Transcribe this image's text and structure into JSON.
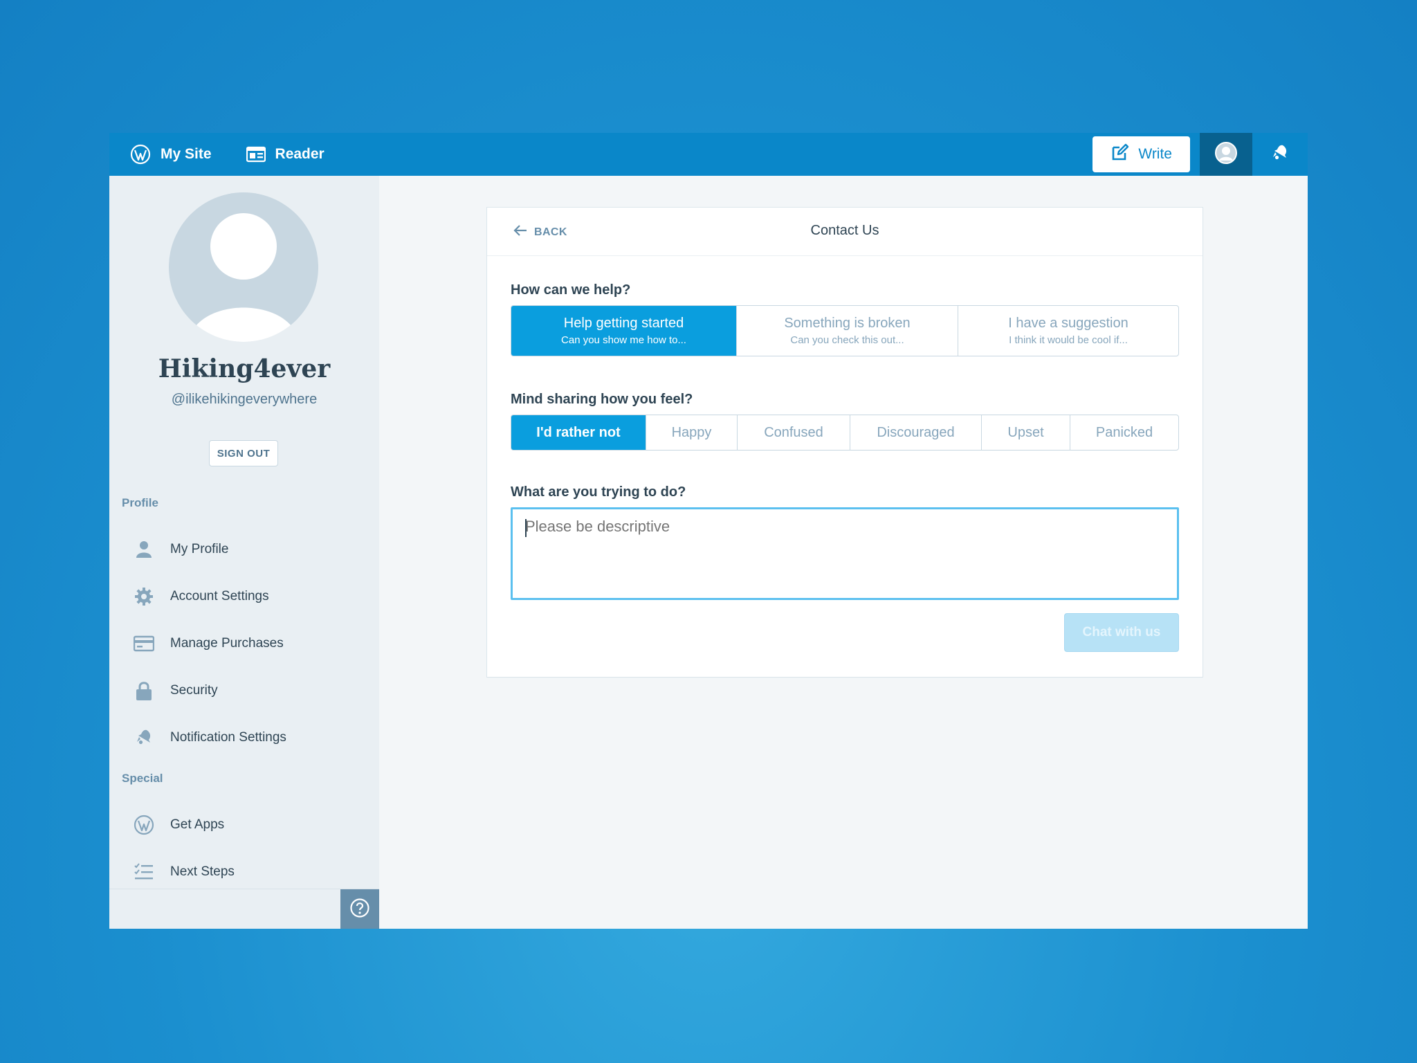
{
  "masterbar": {
    "my_site": "My Site",
    "reader": "Reader",
    "write": "Write"
  },
  "profile": {
    "display_name": "Hiking4ever",
    "username": "@ilikehikingeverywhere",
    "sign_out": "SIGN OUT"
  },
  "sidebar": {
    "profile_section": "Profile",
    "profile_items": [
      {
        "label": "My Profile",
        "icon": "user-icon"
      },
      {
        "label": "Account Settings",
        "icon": "gear-icon"
      },
      {
        "label": "Manage Purchases",
        "icon": "credit-card-icon"
      },
      {
        "label": "Security",
        "icon": "lock-icon"
      },
      {
        "label": "Notification Settings",
        "icon": "bell-icon"
      }
    ],
    "special_section": "Special",
    "special_items": [
      {
        "label": "Get Apps",
        "icon": "wordpress-icon"
      },
      {
        "label": "Next Steps",
        "icon": "checklist-icon"
      }
    ]
  },
  "contact": {
    "back": "BACK",
    "title": "Contact Us",
    "help_question": "How can we help?",
    "help_options": [
      {
        "title": "Help getting started",
        "subtitle": "Can you show me how to...",
        "selected": true
      },
      {
        "title": "Something is broken",
        "subtitle": "Can you check this out...",
        "selected": false
      },
      {
        "title": "I have a suggestion",
        "subtitle": "I think it would be cool if...",
        "selected": false
      }
    ],
    "feel_question": "Mind sharing how you feel?",
    "feel_options": [
      "I'd rather not",
      "Happy",
      "Confused",
      "Discouraged",
      "Upset",
      "Panicked"
    ],
    "feel_selected": "I'd rather not",
    "do_question": "What are you trying to do?",
    "textarea_placeholder": "Please be descriptive",
    "textarea_value": "",
    "chat_button": "Chat with us"
  },
  "colors": {
    "accent": "#0a9ede",
    "masterbar": "#0a87c9",
    "text_dark": "#2e4453",
    "text_muted": "#87a6bc"
  }
}
